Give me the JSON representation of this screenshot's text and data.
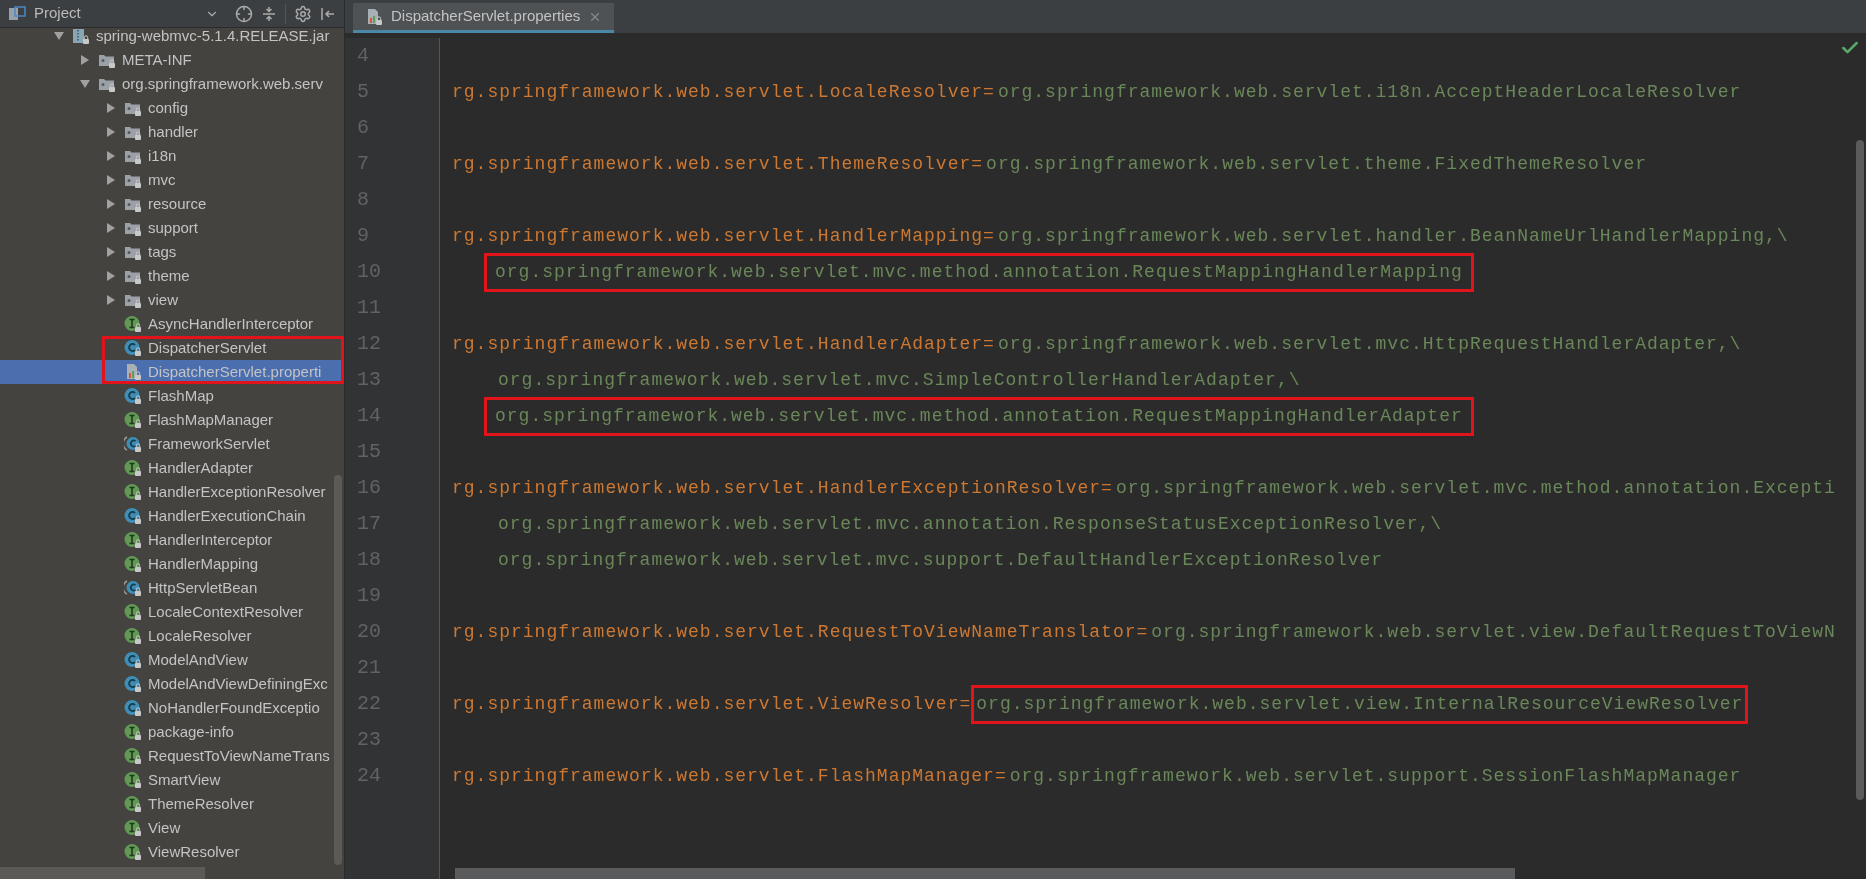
{
  "sidebar": {
    "title": "Project",
    "tree": [
      {
        "label": "spring-webmvc-5.1.4.RELEASE.jar",
        "kind": "jar",
        "expanded": true,
        "selected": false,
        "boxed": false,
        "children": [
          {
            "label": "META-INF",
            "kind": "package",
            "expanded": false,
            "selected": false,
            "boxed": false
          },
          {
            "label": "org.springframework.web.serv",
            "kind": "package",
            "expanded": true,
            "selected": false,
            "boxed": false,
            "children": [
              {
                "label": "config",
                "kind": "package",
                "expanded": false,
                "selected": false,
                "boxed": false
              },
              {
                "label": "handler",
                "kind": "package",
                "expanded": false,
                "selected": false,
                "boxed": false
              },
              {
                "label": "i18n",
                "kind": "package",
                "expanded": false,
                "selected": false,
                "boxed": false
              },
              {
                "label": "mvc",
                "kind": "package",
                "expanded": false,
                "selected": false,
                "boxed": false
              },
              {
                "label": "resource",
                "kind": "package",
                "expanded": false,
                "selected": false,
                "boxed": false
              },
              {
                "label": "support",
                "kind": "package",
                "expanded": false,
                "selected": false,
                "boxed": false
              },
              {
                "label": "tags",
                "kind": "package",
                "expanded": false,
                "selected": false,
                "boxed": false
              },
              {
                "label": "theme",
                "kind": "package",
                "expanded": false,
                "selected": false,
                "boxed": false
              },
              {
                "label": "view",
                "kind": "package",
                "expanded": false,
                "selected": false,
                "boxed": false
              },
              {
                "label": "AsyncHandlerInterceptor",
                "kind": "interface",
                "selected": false,
                "boxed": false
              },
              {
                "label": "DispatcherServlet",
                "kind": "class",
                "selected": false,
                "boxed": true
              },
              {
                "label": "DispatcherServlet.properti",
                "kind": "properties",
                "selected": true,
                "boxed": true
              },
              {
                "label": "FlashMap",
                "kind": "class",
                "selected": false,
                "boxed": false
              },
              {
                "label": "FlashMapManager",
                "kind": "interface",
                "selected": false,
                "boxed": false
              },
              {
                "label": "FrameworkServlet",
                "kind": "abstract_class",
                "selected": false,
                "boxed": false
              },
              {
                "label": "HandlerAdapter",
                "kind": "interface",
                "selected": false,
                "boxed": false
              },
              {
                "label": "HandlerExceptionResolver",
                "kind": "interface",
                "selected": false,
                "boxed": false
              },
              {
                "label": "HandlerExecutionChain",
                "kind": "class",
                "selected": false,
                "boxed": false
              },
              {
                "label": "HandlerInterceptor",
                "kind": "interface",
                "selected": false,
                "boxed": false
              },
              {
                "label": "HandlerMapping",
                "kind": "interface",
                "selected": false,
                "boxed": false
              },
              {
                "label": "HttpServletBean",
                "kind": "abstract_class",
                "selected": false,
                "boxed": false
              },
              {
                "label": "LocaleContextResolver",
                "kind": "interface",
                "selected": false,
                "boxed": false
              },
              {
                "label": "LocaleResolver",
                "kind": "interface",
                "selected": false,
                "boxed": false
              },
              {
                "label": "ModelAndView",
                "kind": "class",
                "selected": false,
                "boxed": false
              },
              {
                "label": "ModelAndViewDefiningExc",
                "kind": "class",
                "selected": false,
                "boxed": false
              },
              {
                "label": "NoHandlerFoundExceptio",
                "kind": "class",
                "selected": false,
                "boxed": false
              },
              {
                "label": "package-info",
                "kind": "interface",
                "selected": false,
                "boxed": false
              },
              {
                "label": "RequestToViewNameTrans",
                "kind": "interface",
                "selected": false,
                "boxed": false
              },
              {
                "label": "SmartView",
                "kind": "interface",
                "selected": false,
                "boxed": false
              },
              {
                "label": "ThemeResolver",
                "kind": "interface",
                "selected": false,
                "boxed": false
              },
              {
                "label": "View",
                "kind": "interface",
                "selected": false,
                "boxed": false
              },
              {
                "label": "ViewResolver",
                "kind": "interface",
                "selected": false,
                "boxed": false
              }
            ]
          }
        ]
      }
    ]
  },
  "editor": {
    "tabs": [
      {
        "label": "DispatcherServlet.properties",
        "selected": true
      }
    ],
    "lines": [
      {
        "number": "4"
      },
      {
        "number": "5",
        "boxed": false,
        "key": "rg.springframework.web.servlet.LocaleResolver=",
        "value": "org.springframework.web.servlet.i18n.AcceptHeaderLocaleResolver"
      },
      {
        "number": "6"
      },
      {
        "number": "7",
        "boxed": false,
        "key": "rg.springframework.web.servlet.ThemeResolver=",
        "value": "org.springframework.web.servlet.theme.FixedThemeResolver"
      },
      {
        "number": "8"
      },
      {
        "number": "9",
        "boxed": false,
        "key": "rg.springframework.web.servlet.HandlerMapping=",
        "value": "org.springframework.web.servlet.handler.BeanNameUrlHandlerMapping,\\"
      },
      {
        "number": "10",
        "boxed": true,
        "value": "org.springframework.web.servlet.mvc.method.annotation.RequestMappingHandlerMapping"
      },
      {
        "number": "11"
      },
      {
        "number": "12",
        "boxed": false,
        "key": "rg.springframework.web.servlet.HandlerAdapter=",
        "value": "org.springframework.web.servlet.mvc.HttpRequestHandlerAdapter,\\"
      },
      {
        "number": "13",
        "boxed": false,
        "value": "org.springframework.web.servlet.mvc.SimpleControllerHandlerAdapter,\\"
      },
      {
        "number": "14",
        "boxed": true,
        "value": "org.springframework.web.servlet.mvc.method.annotation.RequestMappingHandlerAdapter"
      },
      {
        "number": "15"
      },
      {
        "number": "16",
        "boxed": false,
        "key": "rg.springframework.web.servlet.HandlerExceptionResolver=",
        "value": "org.springframework.web.servlet.mvc.method.annotation.Excepti"
      },
      {
        "number": "17",
        "boxed": false,
        "value": "org.springframework.web.servlet.mvc.annotation.ResponseStatusExceptionResolver,\\"
      },
      {
        "number": "18",
        "boxed": false,
        "value": "org.springframework.web.servlet.mvc.support.DefaultHandlerExceptionResolver"
      },
      {
        "number": "19"
      },
      {
        "number": "20",
        "boxed": false,
        "key": "rg.springframework.web.servlet.RequestToViewNameTranslator=",
        "value": "org.springframework.web.servlet.view.DefaultRequestToViewN"
      },
      {
        "number": "21"
      },
      {
        "number": "22",
        "boxed": true,
        "key": "rg.springframework.web.servlet.ViewResolver=",
        "value": "org.springframework.web.servlet.view.InternalResourceViewResolver"
      },
      {
        "number": "23"
      },
      {
        "number": "24",
        "boxed": false,
        "key": "rg.springframework.web.servlet.FlashMapManager=",
        "value": "org.springframework.web.servlet.support.SessionFlashMapManager"
      }
    ]
  }
}
